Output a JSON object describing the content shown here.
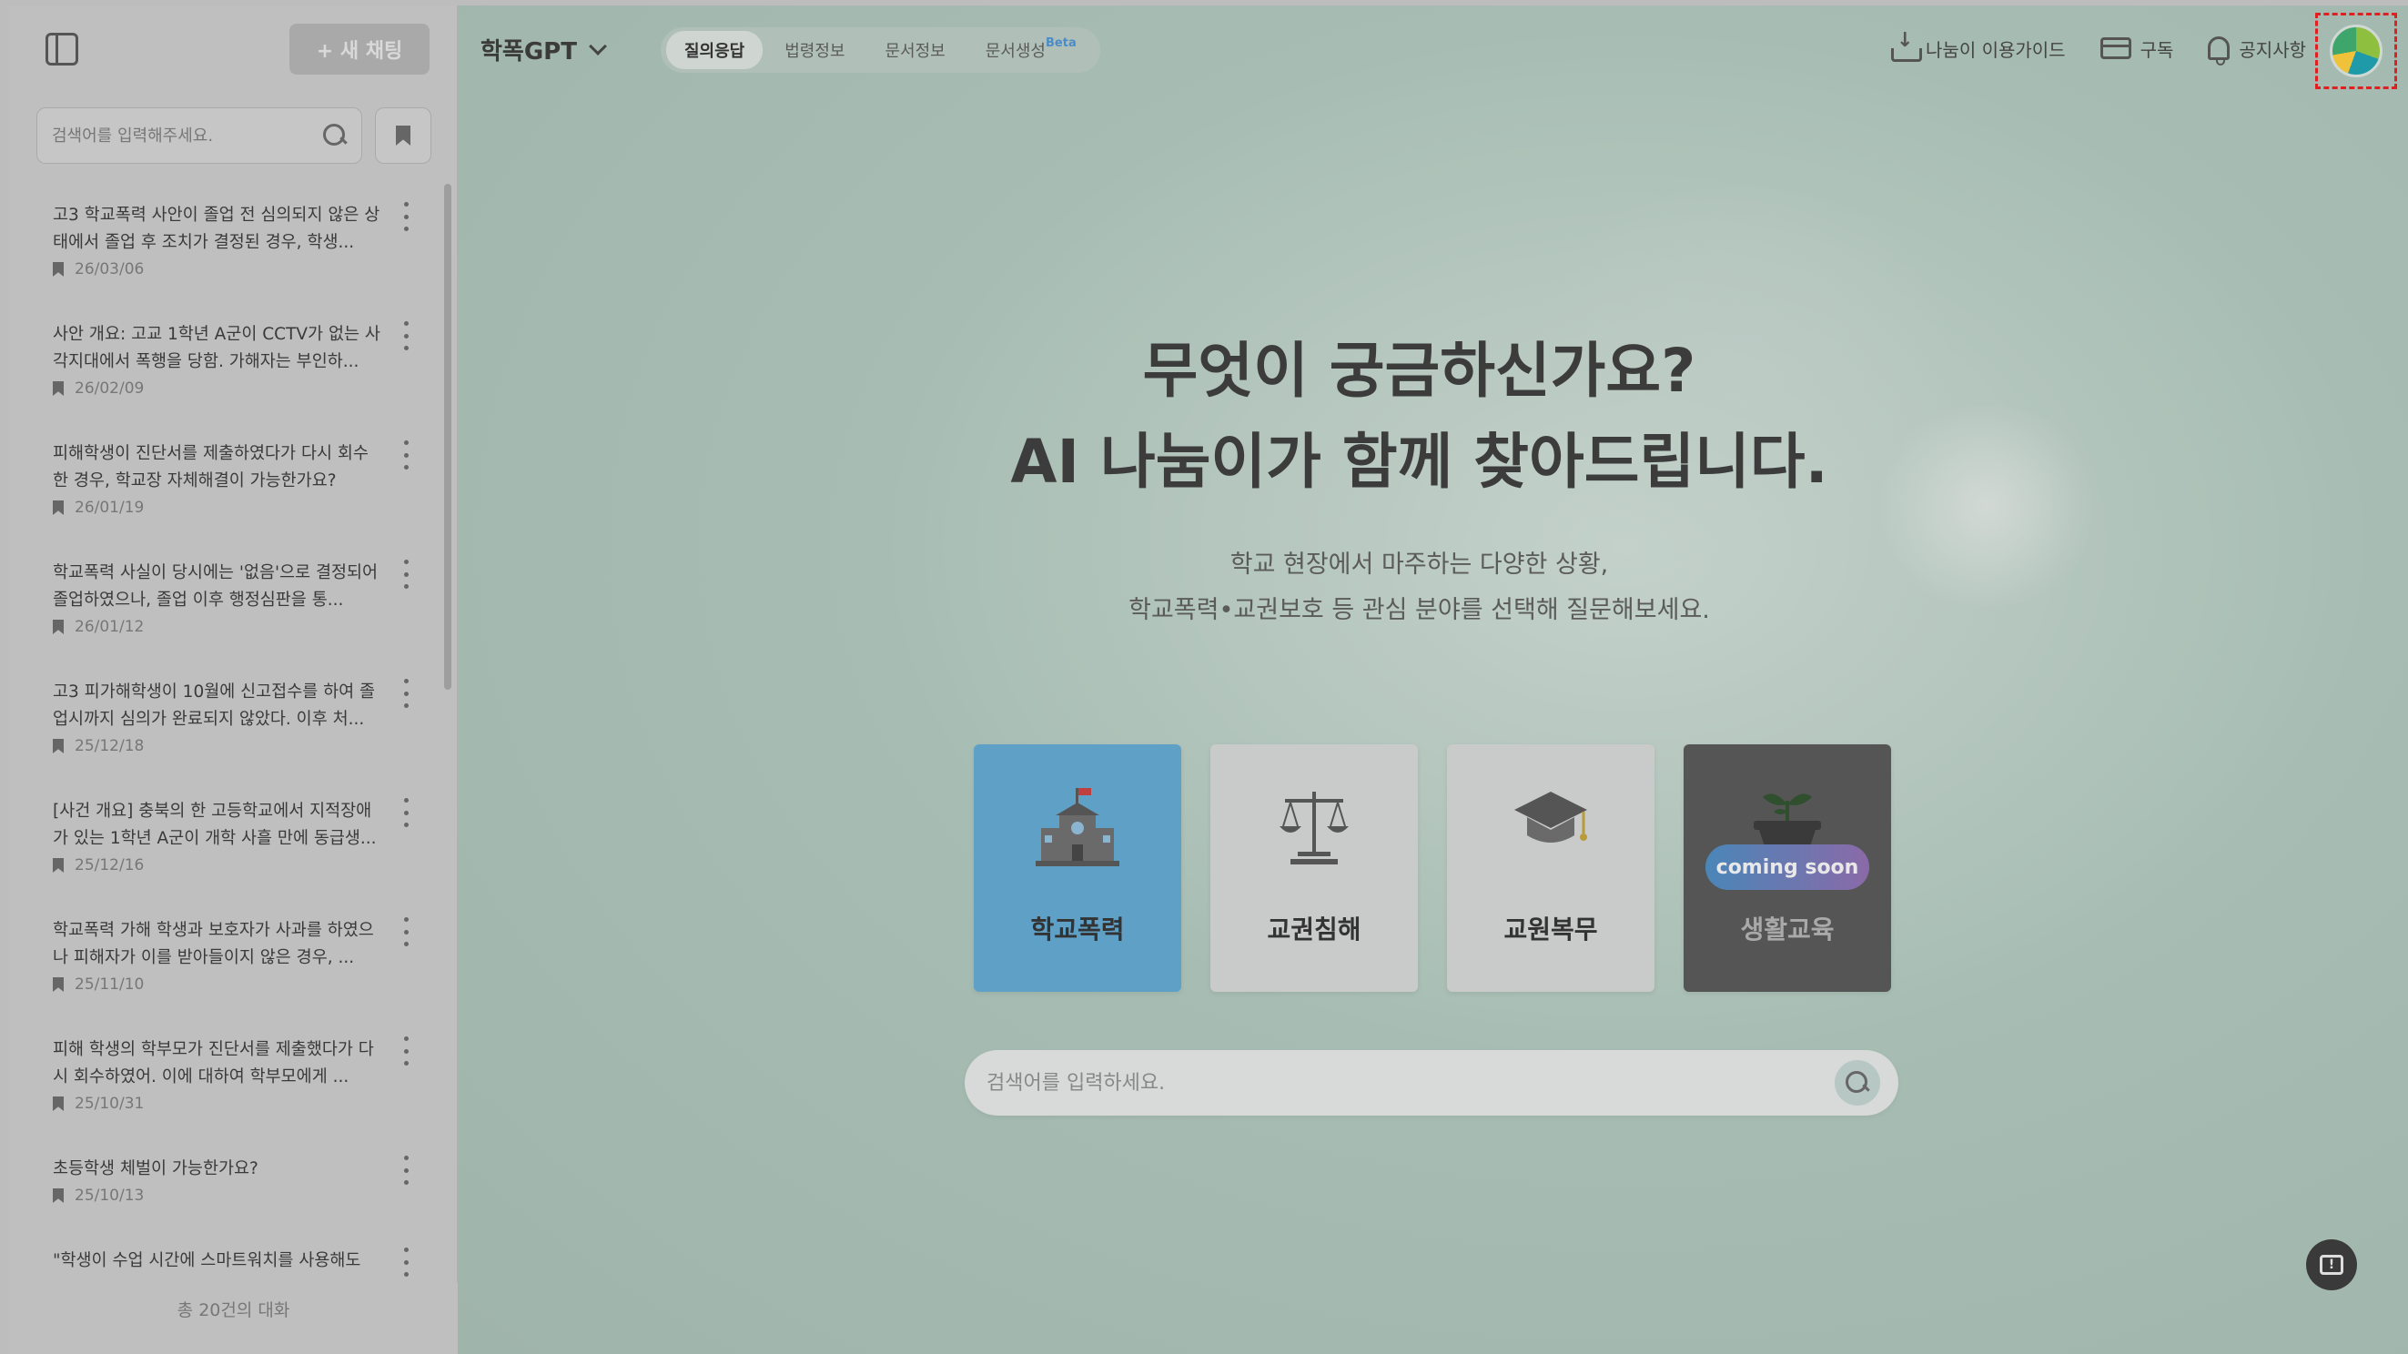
{
  "sidebar": {
    "new_chat_label": "+ 새 채팅",
    "search_placeholder": "검색어를 입력해주세요.",
    "footer": "총 20건의 대화",
    "items": [
      {
        "title": "고3 학교폭력 사안이 졸업 전 심의되지 않은 상태에서 졸업 후 조치가 결정된 경우, 학생...",
        "date": "26/03/06"
      },
      {
        "title": "사안 개요: 고교 1학년 A군이 CCTV가 없는 사각지대에서 폭행을 당함. 가해자는 부인하...",
        "date": "26/02/09"
      },
      {
        "title": "피해학생이 진단서를 제출하였다가 다시 회수한 경우, 학교장 자체해결이 가능한가요?",
        "date": "26/01/19"
      },
      {
        "title": "학교폭력 사실이 당시에는 '없음'으로 결정되어 졸업하였으나, 졸업 이후 행정심판을 통...",
        "date": "26/01/12"
      },
      {
        "title": "고3 피가해학생이 10월에 신고접수를 하여 졸업시까지 심의가 완료되지 않았다. 이후 처...",
        "date": "25/12/18"
      },
      {
        "title": "[사건 개요] 충북의 한 고등학교에서 지적장애가 있는 1학년 A군이 개학 사흘 만에 동급생...",
        "date": "25/12/16"
      },
      {
        "title": "학교폭력 가해 학생과 보호자가 사과를 하였으나 피해자가 이를 받아들이지 않은 경우, ...",
        "date": "25/11/10"
      },
      {
        "title": "피해 학생의 학부모가 진단서를 제출했다가 다시 회수하였어. 이에 대하여 학부모에게 ...",
        "date": "25/10/31"
      },
      {
        "title": "초등학생 체벌이 가능한가요?",
        "date": "25/10/13"
      },
      {
        "title": "\"학생이 수업 시간에 스마트워치를 사용해도",
        "date": ""
      }
    ]
  },
  "header": {
    "brand": "학폭GPT",
    "tabs": [
      {
        "label": "질의응답",
        "active": true
      },
      {
        "label": "법령정보",
        "active": false
      },
      {
        "label": "문서정보",
        "active": false
      },
      {
        "label": "문서생성",
        "badge": "Beta",
        "active": false
      }
    ],
    "guide_label": "나눔이 이용가이드",
    "subscribe_label": "구독",
    "notice_label": "공지사항"
  },
  "hero": {
    "title_line1": "무엇이 궁금하신가요?",
    "title_line2": "AI 나눔이가 함께 찾아드립니다.",
    "sub_line1": "학교 현장에서 마주하는 다양한 상황,",
    "sub_line2": "학교폭력•교권보호 등 관심 분야를 선택해 질문해보세요."
  },
  "categories": [
    {
      "label": "학교폭력",
      "icon": "school-icon",
      "state": "selected"
    },
    {
      "label": "교권침해",
      "icon": "scale-icon",
      "state": "normal"
    },
    {
      "label": "교원복무",
      "icon": "graduation-cap-icon",
      "state": "normal"
    },
    {
      "label": "생활교육",
      "icon": "plant-icon",
      "state": "disabled",
      "badge": "coming soon"
    }
  ],
  "main_search": {
    "placeholder": "검색어를 입력하세요."
  },
  "colors": {
    "accent_blue": "#5fa0c7",
    "highlight_red": "#e02020"
  }
}
